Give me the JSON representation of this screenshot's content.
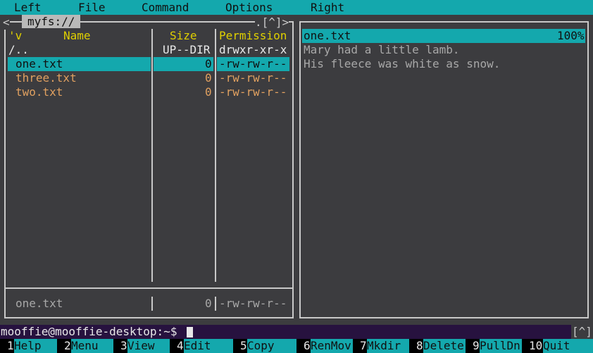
{
  "menu": [
    "Left",
    "File",
    "Command",
    "Options",
    "Right"
  ],
  "left_panel": {
    "title": "myfs://",
    "corner_left": "<",
    "corner_right": ".[^]>",
    "columns": {
      "sort": "'v",
      "name": "Name",
      "size": "Size",
      "perm": "Permission"
    },
    "rows": [
      {
        "name": "/..",
        "size": "UP--DIR",
        "perm": "drwxr-xr-x"
      },
      {
        "name": "one.txt",
        "size": "0",
        "perm": "-rw-rw-r--"
      },
      {
        "name": "three.txt",
        "size": "0",
        "perm": "-rw-rw-r--"
      },
      {
        "name": "two.txt",
        "size": "0",
        "perm": "-rw-rw-r--"
      }
    ],
    "status": {
      "name": "one.txt",
      "size": "0",
      "perm": "-rw-rw-r--"
    }
  },
  "right_panel": {
    "file": "one.txt",
    "percent": "100%",
    "lines": [
      "Mary had a little lamb.",
      "His fleece was white as snow."
    ]
  },
  "command_line": {
    "prompt": "mooffie@mooffie-desktop:~$",
    "corner": "[^]"
  },
  "fkeys": [
    {
      "num": "1",
      "label": "Help"
    },
    {
      "num": "2",
      "label": "Menu"
    },
    {
      "num": "3",
      "label": "View"
    },
    {
      "num": "4",
      "label": "Edit"
    },
    {
      "num": "5",
      "label": "Copy"
    },
    {
      "num": "6",
      "label": "RenMov"
    },
    {
      "num": "7",
      "label": "Mkdir"
    },
    {
      "num": "8",
      "label": "Delete"
    },
    {
      "num": "9",
      "label": "PullDn"
    },
    {
      "num": "10",
      "label": "Quit"
    }
  ],
  "colors": {
    "accent": "#14a8ad",
    "panel_bg": "#3c3c3f",
    "header": "#e0d000",
    "file": "#e0a060",
    "cmdline_bg": "#27123f"
  }
}
